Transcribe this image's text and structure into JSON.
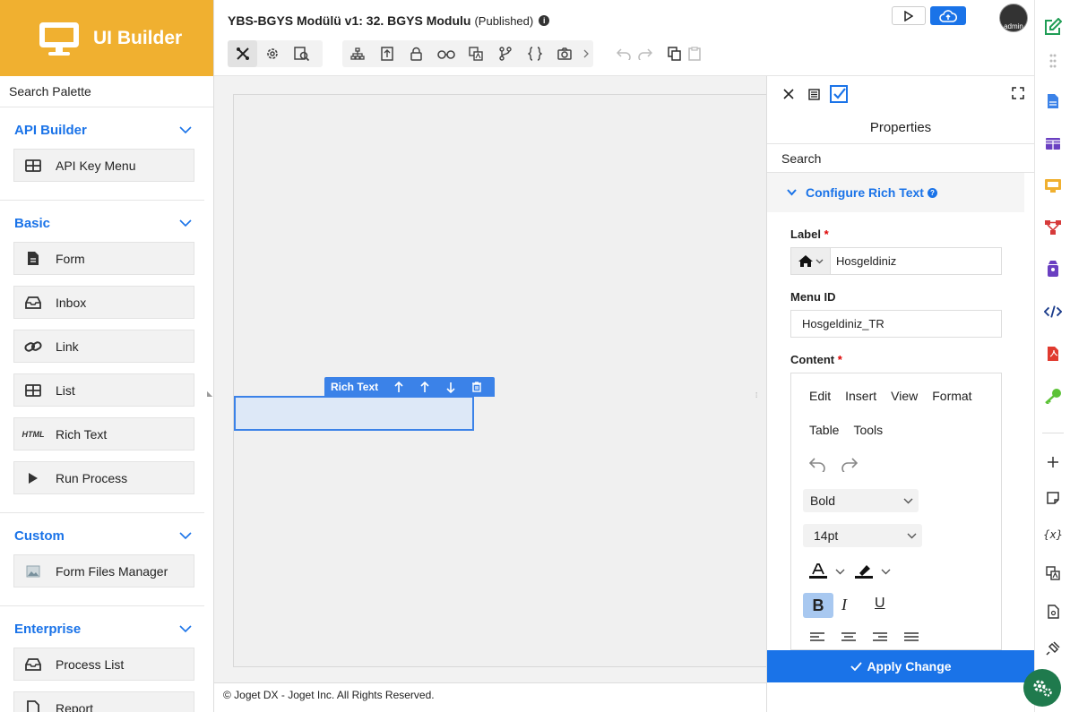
{
  "palette": {
    "brand": "UI Builder",
    "search_placeholder": "Search Palette",
    "groups": [
      {
        "name": "API Builder",
        "items": [
          {
            "label": "API Key Menu"
          }
        ]
      },
      {
        "name": "Basic",
        "items": [
          {
            "label": "Form"
          },
          {
            "label": "Inbox"
          },
          {
            "label": "Link"
          },
          {
            "label": "List"
          },
          {
            "label": "Rich Text",
            "badge": "HTML"
          },
          {
            "label": "Run Process"
          }
        ]
      },
      {
        "name": "Custom",
        "items": [
          {
            "label": "Form Files Manager"
          }
        ]
      },
      {
        "name": "Enterprise",
        "items": [
          {
            "label": "Process List"
          },
          {
            "label": "Report"
          }
        ]
      }
    ]
  },
  "header": {
    "title": "YBS-BGYS Modülü v1: 32. BGYS Modulu",
    "status": "(Published)",
    "info": "i",
    "avatar": "admin"
  },
  "canvas": {
    "element_label": "Rich Text"
  },
  "footer": {
    "text": "© Joget DX - Joget Inc. All Rights Reserved."
  },
  "properties": {
    "title": "Properties",
    "search_placeholder": "Search",
    "section": "Configure Rich Text",
    "section_help": "?",
    "label_field": {
      "label": "Label",
      "required": "*",
      "value": "Hosgeldiniz"
    },
    "menu_id_field": {
      "label": "Menu ID",
      "value": "Hosgeldiniz_TR"
    },
    "content_field": {
      "label": "Content",
      "required": "*"
    },
    "editor": {
      "menu": [
        "Edit",
        "Insert",
        "View",
        "Format"
      ],
      "menu2": [
        "Table",
        "Tools"
      ],
      "block_format": "Bold",
      "font_size": "14pt",
      "bold": "B",
      "italic": "I",
      "underline": "U"
    },
    "apply_label": "Apply Change"
  },
  "colors": {
    "brand": "#f0b030",
    "accent": "#1a73e8",
    "fab": "#1f7a4d"
  }
}
